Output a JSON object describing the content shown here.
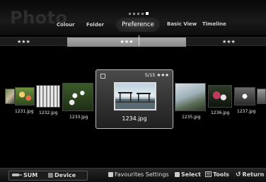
{
  "header": {
    "title": "Photo",
    "tabs": [
      {
        "label": "Colour"
      },
      {
        "label": "Folder"
      },
      {
        "label": "Preference",
        "active": true
      },
      {
        "label": "Basic View"
      },
      {
        "label": "Timeline"
      }
    ]
  },
  "rating_bar": {
    "left": "★★★",
    "center": "★★★",
    "right": "★★★"
  },
  "photos": [
    {
      "name": "1231.jpg"
    },
    {
      "name": "1232.jpg"
    },
    {
      "name": "1233.jpg"
    },
    {
      "name": "1234.jpg",
      "selected": true
    },
    {
      "name": "1235.jpg"
    },
    {
      "name": "1236.jpg"
    },
    {
      "name": "1237.jpg"
    }
  ],
  "focused": {
    "count": "5/15 ★★★",
    "name": "1234.jpg"
  },
  "footer": {
    "sum": "SUM",
    "device": "Device",
    "favourites_settings": "Favourites Settings",
    "select": "Select",
    "tools": "Tools",
    "return": "Return"
  },
  "colors": {
    "background": "#000000",
    "rating_highlight": "#a0a0a0"
  }
}
